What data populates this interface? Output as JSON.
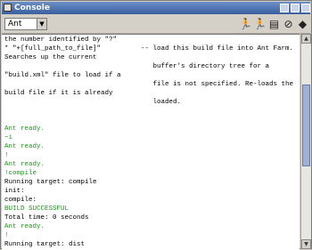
{
  "window": {
    "title": "Console"
  },
  "toolbar": {
    "selected_tool": "Ant",
    "buttons": [
      {
        "name": "run-icon",
        "glyph": "🏃"
      },
      {
        "name": "run-again-icon",
        "glyph": "🏃"
      },
      {
        "name": "clear-icon",
        "glyph": "▤"
      },
      {
        "name": "stop-icon",
        "glyph": "⊘"
      },
      {
        "name": "close-console-icon",
        "glyph": "◆"
      }
    ]
  },
  "colors": {
    "output": "#000000",
    "status": "#1f8f1f"
  },
  "console": {
    "lines": [
      {
        "text": "the number identified by \"?\"",
        "style": "plain"
      },
      {
        "text": "* \"+[full_path_to_file]\"          -- load this build file into Ant Farm.",
        "style": "plain"
      },
      {
        "text": "Searches up the current",
        "style": "plain"
      },
      {
        "text": "                                     buffer's directory tree for a",
        "style": "plain"
      },
      {
        "text": "\"build.xml\" file to load if a",
        "style": "plain"
      },
      {
        "text": "                                     file is not specified. Re-loads the",
        "style": "plain"
      },
      {
        "text": "build file if it is already",
        "style": "plain"
      },
      {
        "text": "                                     loaded.",
        "style": "plain"
      },
      {
        "text": "",
        "style": "plain"
      },
      {
        "text": "",
        "style": "plain"
      },
      {
        "text": "Ant ready.",
        "style": "status"
      },
      {
        "text": "~i",
        "style": "status"
      },
      {
        "text": "Ant ready.",
        "style": "status"
      },
      {
        "text": "!",
        "style": "status"
      },
      {
        "text": "Ant ready.",
        "style": "status"
      },
      {
        "text": "!compile",
        "style": "status"
      },
      {
        "text": "Running target: compile",
        "style": "plain"
      },
      {
        "text": "init:",
        "style": "plain"
      },
      {
        "text": "compile:",
        "style": "plain"
      },
      {
        "text": "BUILD SUCCESSFUL",
        "style": "status"
      },
      {
        "text": "Total time: 0 seconds",
        "style": "plain"
      },
      {
        "text": "Ant ready.",
        "style": "status"
      },
      {
        "text": "!",
        "style": "status"
      },
      {
        "text": "Running target: dist",
        "style": "plain"
      }
    ]
  }
}
